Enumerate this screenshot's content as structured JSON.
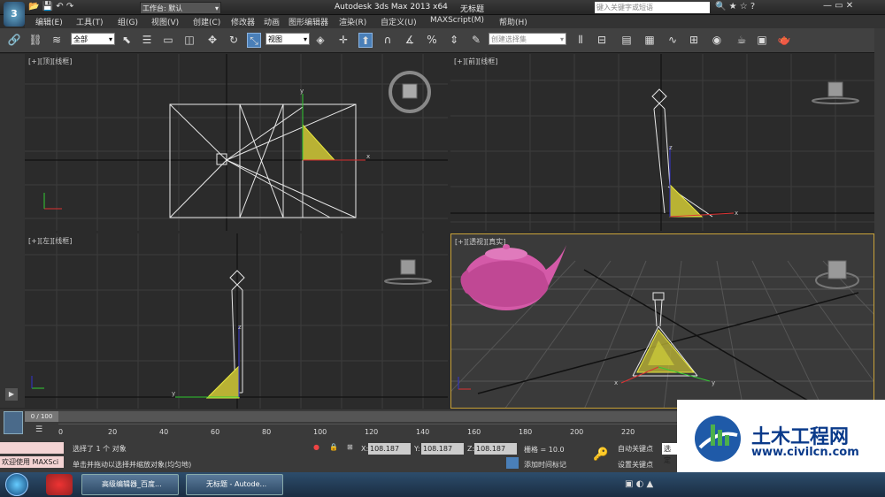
{
  "title_bar": {
    "workspace_label": "工作台: 默认",
    "app_title": "Autodesk 3ds Max  2013 x64",
    "doc_title": "无标题",
    "search_placeholder": "键入关键字或短语"
  },
  "menu": [
    "编辑(E)",
    "工具(T)",
    "组(G)",
    "视图(V)",
    "创建(C)",
    "修改器",
    "动画",
    "图形编辑器",
    "渲染(R)",
    "自定义(U)",
    "MAXScript(M)",
    "帮助(H)"
  ],
  "toolbar": {
    "filter_value": "全部",
    "coord_value": "视图",
    "named_selection_placeholder": "创建选择集"
  },
  "viewports": [
    {
      "label": "[+][顶][线框]"
    },
    {
      "label": "[+][前][线框]"
    },
    {
      "label": "[+][左][线框]"
    },
    {
      "label": "[+][透视][真实]"
    }
  ],
  "time_slider": {
    "position": "0 / 100",
    "ticks": [
      "0",
      "20",
      "40",
      "60",
      "80",
      "100",
      "120",
      "140",
      "160",
      "180",
      "200",
      "220"
    ]
  },
  "status": {
    "script_label": "欢迎使用 MAXSci",
    "selection_text": "选择了 1 个 对象",
    "prompt_text": "单击并拖动以选择并缩放对象(均匀地)",
    "x_label": "X:",
    "x_value": "108.187",
    "y_label": "Y:",
    "y_value": "108.187",
    "z_label": "Z:",
    "z_value": "108.187",
    "grid_text": "栅格 = 10.0",
    "auto_key": "自动关键点",
    "set_key": "设置关键点",
    "add_time_tag": "添加时间标记",
    "selected_btn": "选定"
  },
  "taskbar": {
    "items": [
      "高级编辑器_百度...",
      "无标题 - Autode..."
    ]
  },
  "watermark": {
    "name": "土木工程网",
    "url": "www.civilcn.com"
  },
  "colors": {
    "active_viewport_border": "#c9a33a",
    "teapot": "#d45aa8",
    "light_cone": "#d8d83a",
    "wire": "#e8e8e8"
  }
}
